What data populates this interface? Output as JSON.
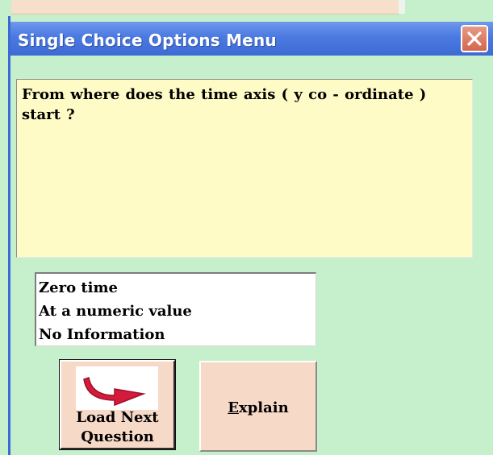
{
  "window": {
    "title": "Single Choice Options Menu",
    "close_icon": "close-icon"
  },
  "question": {
    "text": "From where does the time axis ( y co - ordinate ) start ?"
  },
  "options": [
    {
      "label": "Zero time"
    },
    {
      "label": "At a numeric value"
    },
    {
      "label": "No Information"
    }
  ],
  "buttons": {
    "load_next": {
      "line1": "Load Next",
      "line2": "Question",
      "icon": "curved-arrow-right-icon"
    },
    "explain": {
      "mnemonic": "E",
      "rest": "xplain"
    }
  },
  "colors": {
    "background": "#c6f0cc",
    "titlebar": "#4a79e0",
    "question_box": "#fffbc6",
    "button_face": "#f7d9c7",
    "arrow": "#d51a3c",
    "close_button": "#d4664e"
  }
}
